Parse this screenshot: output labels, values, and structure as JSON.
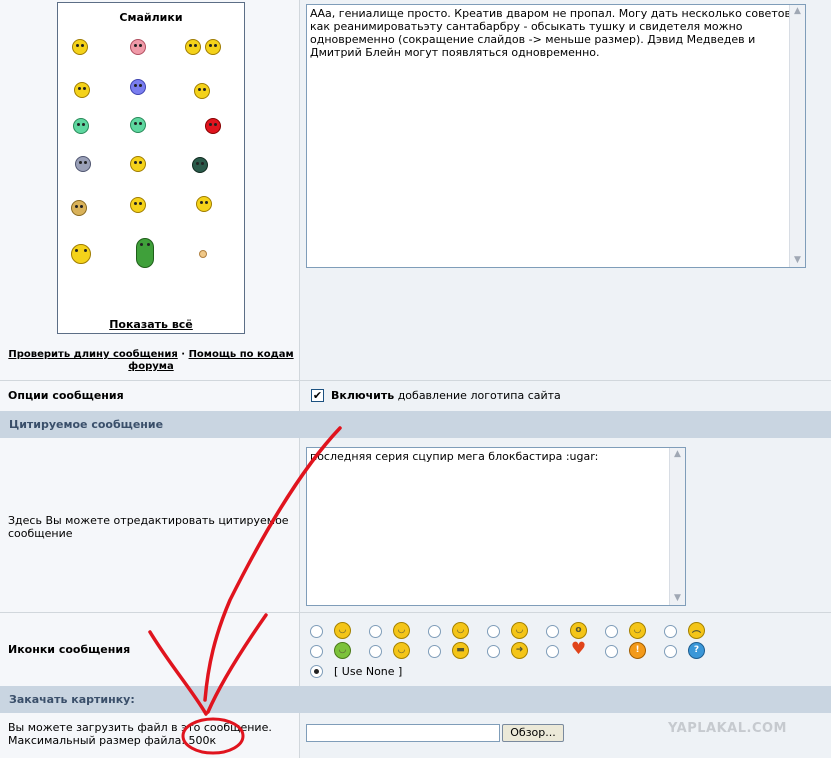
{
  "smilies": {
    "title": "Смайлики",
    "show_all": "Показать всё",
    "icons": [
      "cool-smiley-icon",
      "love-smiley-icon",
      "dance-smiley-icon",
      "argue-smiley-icon",
      "blue-smiley-icon",
      "thinking-smiley-icon",
      "gun-smiley-icon",
      "green-smiley-icon",
      "shoot-smiley-icon",
      "walk-smiley-icon",
      "victory-smiley-icon",
      "shadow-smiley-icon",
      "clap-smiley-icon",
      "cheer-smiley-icon",
      "horns-smiley-icon",
      "laugh-smiley-icon",
      "green-blob-icon",
      "tiny-smiley-icon"
    ]
  },
  "links": {
    "check_length": "Проверить длину сообщения",
    "separator": "·",
    "help_codes": "Помощь по кодам форума"
  },
  "message": {
    "text": "ААа, гениалище просто. Креатив дваром не пропал. Могу дать несколько советов, как реанимироватьэту сантабарбру - обсыкать тушку и свидетеля можно одновременно (сокращение слайдов -> меньше размер). Дэвид Медведев и Дмитрий Блейн могут появляться одновременно."
  },
  "options": {
    "label": "Опции сообщения",
    "checkbox_mark": "✔",
    "checkbox_bold": "Включить",
    "checkbox_rest": " добавление логотипа сайта"
  },
  "quote": {
    "header": "Цитируемое сообщение",
    "label": "Здесь Вы можете отредактировать цитируемое сообщение",
    "text": "последняя серия сцупир мега блокбастира :ugar:"
  },
  "icons": {
    "label": "Иконки сообщения",
    "row1": [
      "smile-icon",
      "wink-icon",
      "tongue-icon",
      "grin-icon",
      "shock-icon",
      "laugh-icon",
      "angry-icon"
    ],
    "row2": [
      "sick-icon",
      "cool-icon",
      "arrow-icon",
      "heart-icon",
      "exclamation-icon",
      "question-icon"
    ],
    "use_none": "[ Use None ]"
  },
  "upload": {
    "header": "Закачать картинку:",
    "line1": "Вы можете загрузить файл в это сообщение.",
    "line2": "Максимальный размер файла: 500к",
    "browse": "Обзор..."
  },
  "watermark": "YAPLAKAL.COM",
  "colors": {
    "section_bar": "#c9d5e1",
    "annotation": "#e0141e"
  }
}
